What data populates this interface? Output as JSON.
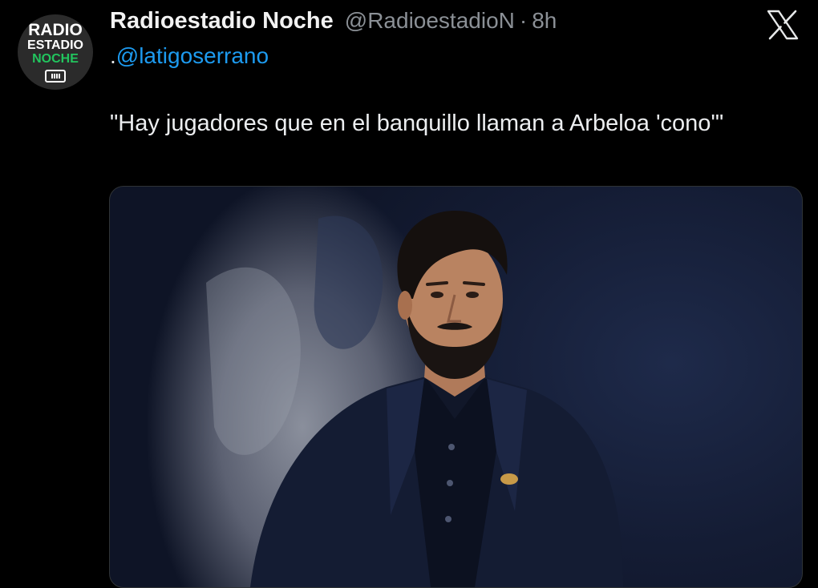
{
  "author": {
    "display_name": "Radioestadio Noche",
    "handle": "@RadioestadioN",
    "separator": "·",
    "time": "8h",
    "avatar": {
      "line1": "RADIO",
      "line2": "ESTADIO",
      "line3": "NOCHE",
      "accent_color": "#22c55e"
    }
  },
  "brand_icon": "x-logo-icon",
  "tweet": {
    "mention_prefix": ".",
    "mention": "@latigoserrano",
    "text": "\"Hay jugadores que en el banquillo llaman a Arbeloa 'cono'\"",
    "link_color": "#1d9bf0"
  },
  "media": {
    "type": "photo",
    "icon": "photo-image"
  }
}
